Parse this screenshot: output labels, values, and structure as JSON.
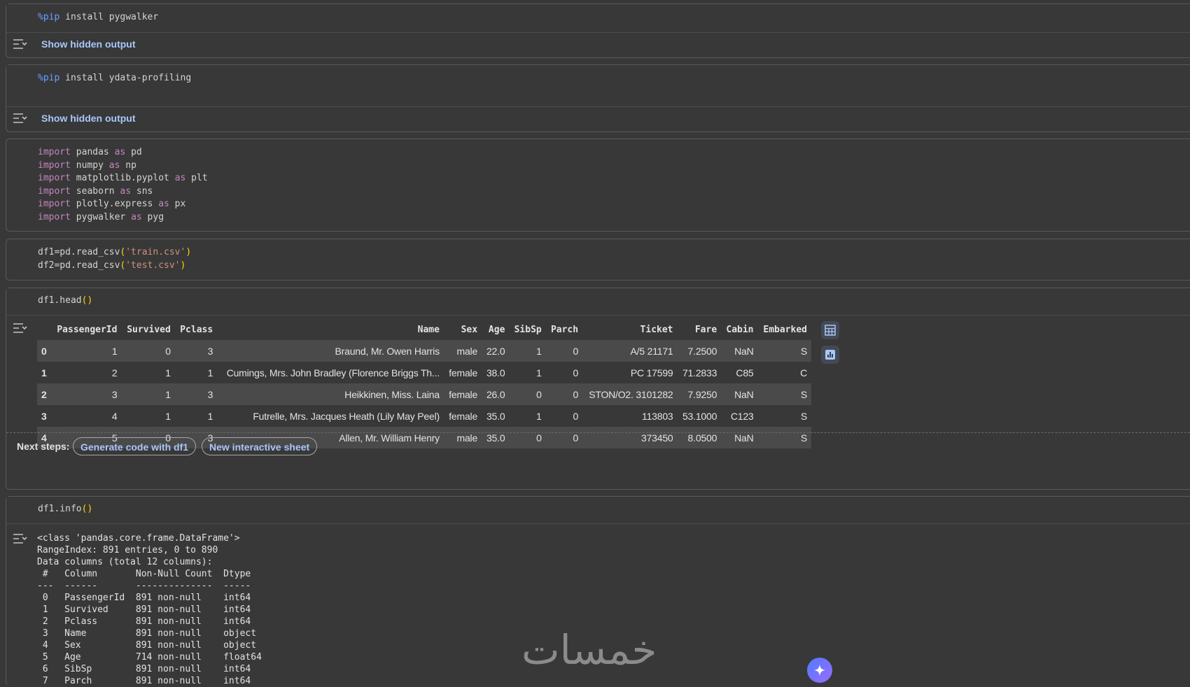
{
  "cells": {
    "pip_pygwalker": {
      "line": [
        "%pip",
        " install pygwalker"
      ],
      "hidden": "Show hidden output"
    },
    "pip_ydata": {
      "line": [
        "%pip",
        " install ydata-profiling"
      ],
      "hidden": "Show hidden output"
    },
    "imports": [
      {
        "kw": "import",
        "mod": " pandas ",
        "as": "as",
        "alias": " pd"
      },
      {
        "kw": "import",
        "mod": " numpy ",
        "as": "as",
        "alias": " np"
      },
      {
        "kw": "import",
        "mod": " matplotlib.pyplot ",
        "as": "as",
        "alias": " plt"
      },
      {
        "kw": "import",
        "mod": " seaborn ",
        "as": "as",
        "alias": " sns"
      },
      {
        "kw": "import",
        "mod": " plotly.express ",
        "as": "as",
        "alias": " px"
      },
      {
        "kw": "import",
        "mod": " pygwalker ",
        "as": "as",
        "alias": " pyg"
      }
    ],
    "read_csv": [
      {
        "pre": "df1=pd.read_csv",
        "open": "(",
        "str": "'train.csv'",
        "close": ")"
      },
      {
        "pre": "df2=pd.read_csv",
        "open": "(",
        "str": "'test.csv'",
        "close": ")"
      }
    ],
    "head": {
      "pre": "df1.head",
      "paren": "()"
    },
    "info": {
      "pre": "df1.info",
      "paren": "()"
    }
  },
  "dataframe": {
    "columns": [
      "",
      "PassengerId",
      "Survived",
      "Pclass",
      "Name",
      "Sex",
      "Age",
      "SibSp",
      "Parch",
      "Ticket",
      "Fare",
      "Cabin",
      "Embarked"
    ],
    "rows": [
      [
        "0",
        "1",
        "0",
        "3",
        "Braund, Mr. Owen Harris",
        "male",
        "22.0",
        "1",
        "0",
        "A/5 21171",
        "7.2500",
        "NaN",
        "S"
      ],
      [
        "1",
        "2",
        "1",
        "1",
        "Cumings, Mrs. John Bradley (Florence Briggs Th...",
        "female",
        "38.0",
        "1",
        "0",
        "PC 17599",
        "71.2833",
        "C85",
        "C"
      ],
      [
        "2",
        "3",
        "1",
        "3",
        "Heikkinen, Miss. Laina",
        "female",
        "26.0",
        "0",
        "0",
        "STON/O2. 3101282",
        "7.9250",
        "NaN",
        "S"
      ],
      [
        "3",
        "4",
        "1",
        "1",
        "Futrelle, Mrs. Jacques Heath (Lily May Peel)",
        "female",
        "35.0",
        "1",
        "0",
        "113803",
        "53.1000",
        "C123",
        "S"
      ],
      [
        "4",
        "5",
        "0",
        "3",
        "Allen, Mr. William Henry",
        "male",
        "35.0",
        "0",
        "0",
        "373450",
        "8.0500",
        "NaN",
        "S"
      ]
    ]
  },
  "next_steps": {
    "label": "Next steps:",
    "generate": "Generate code with df1",
    "interactive": "New interactive sheet"
  },
  "info_output": "<class 'pandas.core.frame.DataFrame'>\nRangeIndex: 891 entries, 0 to 890\nData columns (total 12 columns):\n #   Column       Non-Null Count  Dtype  \n---  ------       --------------  -----  \n 0   PassengerId  891 non-null    int64  \n 1   Survived     891 non-null    int64  \n 2   Pclass       891 non-null    int64  \n 3   Name         891 non-null    object \n 4   Sex          891 non-null    object \n 5   Age          714 non-null    float64\n 6   SibSp        891 non-null    int64  \n 7   Parch        891 non-null    int64  ",
  "watermark": "خمسات",
  "icons": {
    "output_toggle": "output-toggle-icon",
    "table_view": "table-icon",
    "chart_suggest": "chart-icon",
    "gemini": "sparkle-icon"
  }
}
